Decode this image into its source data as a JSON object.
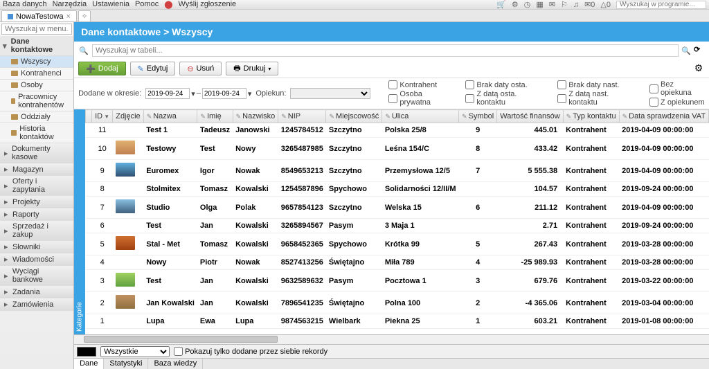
{
  "topbar": {
    "menu": [
      "Baza danych",
      "Narzędzia",
      "Ustawienia",
      "Pomoc",
      "Wyślij zgłoszenie"
    ],
    "search_placeholder": "Wyszukaj w programie...",
    "badge_mail": "0",
    "badge_bell": "0"
  },
  "tab": {
    "label": "NowaTestowa"
  },
  "sidebar": {
    "search_placeholder": "Wyszukaj w menu...",
    "group": "Dane kontaktowe",
    "children": [
      "Wszyscy",
      "Kontrahenci",
      "Osoby",
      "Pracownicy kontrahentów",
      "Oddziały",
      "Historia kontaktów"
    ],
    "selected_index": 0,
    "sections": [
      "Dokumenty kasowe",
      "Magazyn",
      "Oferty i zapytania",
      "Projekty",
      "Raporty",
      "Sprzedaż i zakup",
      "Słowniki",
      "Wiadomości",
      "Wyciągi bankowe",
      "Zadania",
      "Zamówienia"
    ]
  },
  "header": {
    "title": "Dane kontaktowe > Wszyscy"
  },
  "searchrow": {
    "placeholder": "Wyszukaj w tabeli..."
  },
  "toolbar": {
    "add": "Dodaj",
    "edit": "Edytuj",
    "delete": "Usuń",
    "print": "Drukuj"
  },
  "filters": {
    "dodane_label": "Dodane w okresie:",
    "date_from": "2019-09-24",
    "date_to": "2019-09-24",
    "opiekun_label": "Opiekun:",
    "checks_col1": [
      "Kontrahent",
      "Osoba prywatna"
    ],
    "checks_col2": [
      "Brak daty osta.",
      "Z datą osta. kontaktu"
    ],
    "checks_col3": [
      "Brak daty nast.",
      "Z datą nast. kontaktu"
    ],
    "checks_col4": [
      "Bez opiekuna",
      "Z opiekunem"
    ]
  },
  "columns": [
    "",
    "ID",
    "Zdjęcie",
    "Nazwa",
    "Imię",
    "Nazwisko",
    "NIP",
    "Miejscowość",
    "Ulica",
    "Symbol",
    "Wartość finansów",
    "Typ kontaktu",
    "Data sprawdzenia VAT"
  ],
  "rows": [
    {
      "id": "11",
      "thumb": "",
      "nazwa": "Test 1",
      "imie": "Tadeusz",
      "nazwisko": "Janowski",
      "nip": "1245784512",
      "miejsc": "Szczytno",
      "ulica": "Polska 25/8",
      "symbol": "9",
      "wartosc": "445.01",
      "typ": "Kontrahent",
      "data": "2019-04-09 00:00:00"
    },
    {
      "id": "10",
      "thumb": "t1",
      "nazwa": "Testowy",
      "imie": "Test",
      "nazwisko": "Nowy",
      "nip": "3265487985",
      "miejsc": "Szczytno",
      "ulica": "Leśna 154/C",
      "symbol": "8",
      "wartosc": "433.42",
      "typ": "Kontrahent",
      "data": "2019-04-09 00:00:00"
    },
    {
      "id": "9",
      "thumb": "t2",
      "nazwa": "Euromex",
      "imie": "Igor",
      "nazwisko": "Nowak",
      "nip": "8549653213",
      "miejsc": "Szczytno",
      "ulica": "Przemysłowa 12/5",
      "symbol": "7",
      "wartosc": "5 555.38",
      "typ": "Kontrahent",
      "data": "2019-04-09 00:00:00"
    },
    {
      "id": "8",
      "thumb": "",
      "nazwa": "Stolmitex",
      "imie": "Tomasz",
      "nazwisko": "Kowalski",
      "nip": "1254587896",
      "miejsc": "Spychowo",
      "ulica": "Solidarności 12/II/M",
      "symbol": "",
      "wartosc": "104.57",
      "typ": "Kontrahent",
      "data": "2019-09-24 00:00:00"
    },
    {
      "id": "7",
      "thumb": "t3",
      "nazwa": "Studio",
      "imie": "Olga",
      "nazwisko": "Polak",
      "nip": "9657854123",
      "miejsc": "Szczytno",
      "ulica": "Welska 15",
      "symbol": "6",
      "wartosc": "211.12",
      "typ": "Kontrahent",
      "data": "2019-04-09 00:00:00"
    },
    {
      "id": "6",
      "thumb": "",
      "nazwa": "Test",
      "imie": "Jan",
      "nazwisko": "Kowalski",
      "nip": "3265894567",
      "miejsc": "Pasym",
      "ulica": "3 Maja 1",
      "symbol": "",
      "wartosc": "2.71",
      "typ": "Kontrahent",
      "data": "2019-09-24 00:00:00"
    },
    {
      "id": "5",
      "thumb": "t4",
      "nazwa": "Stal - Met",
      "imie": "Tomasz",
      "nazwisko": "Kowalski",
      "nip": "9658452365",
      "miejsc": "Spychowo",
      "ulica": "Krótka 99",
      "symbol": "5",
      "wartosc": "267.43",
      "typ": "Kontrahent",
      "data": "2019-03-28 00:00:00"
    },
    {
      "id": "4",
      "thumb": "",
      "nazwa": "Nowy",
      "imie": "Piotr",
      "nazwisko": "Nowak",
      "nip": "8527413256",
      "miejsc": "Świętajno",
      "ulica": "Miła 789",
      "symbol": "4",
      "wartosc": "-25 989.93",
      "typ": "Kontrahent",
      "data": "2019-03-28 00:00:00"
    },
    {
      "id": "3",
      "thumb": "t5",
      "nazwa": "Test",
      "imie": "Jan",
      "nazwisko": "Kowalski",
      "nip": "9632589632",
      "miejsc": "Pasym",
      "ulica": "Pocztowa 1",
      "symbol": "3",
      "wartosc": "679.76",
      "typ": "Kontrahent",
      "data": "2019-03-22 00:00:00"
    },
    {
      "id": "2",
      "thumb": "t6",
      "nazwa": "Jan Kowalski",
      "imie": "Jan",
      "nazwisko": "Kowalski",
      "nip": "7896541235",
      "miejsc": "Świętajno",
      "ulica": "Polna 100",
      "symbol": "2",
      "wartosc": "-4 365.06",
      "typ": "Kontrahent",
      "data": "2019-03-04 00:00:00"
    },
    {
      "id": "1",
      "thumb": "",
      "nazwa": "Lupa",
      "imie": "Ewa",
      "nazwisko": "Lupa",
      "nip": "9874563215",
      "miejsc": "Wielbark",
      "ulica": "Piekna 25",
      "symbol": "1",
      "wartosc": "603.21",
      "typ": "Kontrahent",
      "data": "2019-01-08 00:00:00"
    }
  ],
  "kategorie": "Kategorie",
  "bottombar": {
    "combo": "Wszystkie",
    "only_own": "Pokazuj tylko dodane przez siebie rekordy"
  },
  "bottomtabs": [
    "Dane",
    "Statystyki",
    "Baza wiedzy"
  ]
}
